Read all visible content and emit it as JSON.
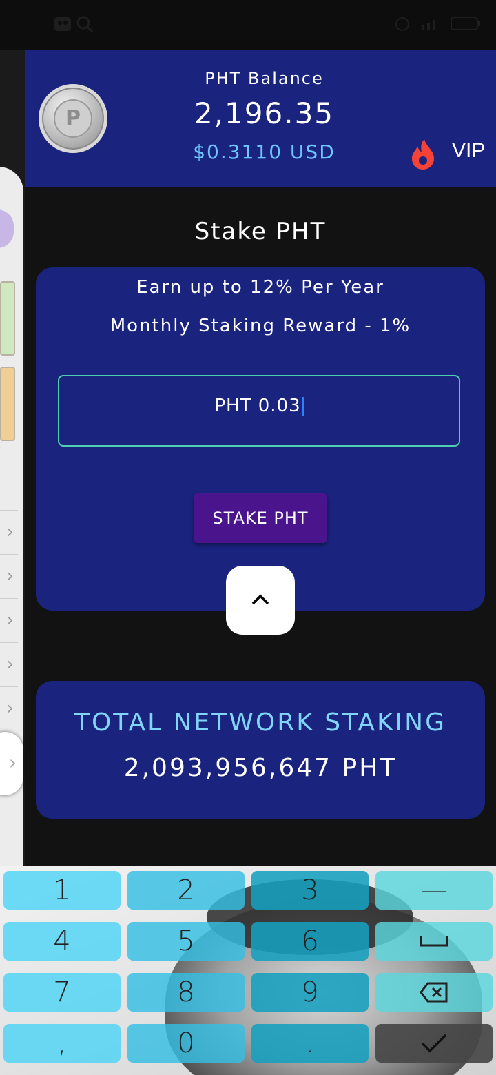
{
  "header": {
    "balance_label": "PHT Balance",
    "balance_value": "2,196.35",
    "balance_usd": "$0.3110 USD",
    "vip_label": "VIP",
    "coin_letter": "P"
  },
  "stake": {
    "title": "Stake PHT",
    "earn_text": "Earn up to 12% Per Year",
    "monthly_text": "Monthly Staking Reward - 1%",
    "amount_value": "PHT 0.03",
    "button_label": "STAKE PHT"
  },
  "network": {
    "label": "TOTAL NETWORK STAKING",
    "value": "2,093,956,647 PHT"
  },
  "keyboard": {
    "keys": [
      "1",
      "2",
      "3",
      "—",
      "4",
      "5",
      "6",
      "␣",
      "7",
      "8",
      "9",
      "⌫",
      ",",
      "0",
      ".",
      "✓"
    ]
  },
  "colors": {
    "header_bg": "#1a237e",
    "accent_usd": "#6ec6ff",
    "button": "#4a148c",
    "field_border": "#4dd0b0"
  },
  "icons": [
    "search-icon",
    "alarm-icon",
    "battery-icon",
    "fire-icon",
    "chevron-up-icon",
    "chevron-right-icon",
    "backspace-icon",
    "check-icon"
  ]
}
